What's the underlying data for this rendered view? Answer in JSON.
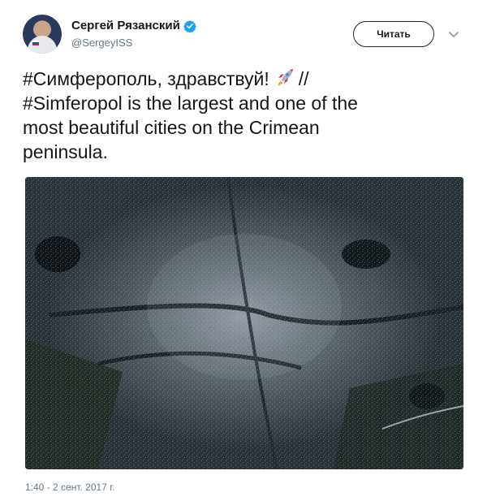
{
  "user": {
    "display_name": "Сергей Рязанский",
    "handle": "@SergeyISS",
    "verified": true
  },
  "actions": {
    "follow_label": "Читать"
  },
  "tweet": {
    "line1_before_icon": "#Симферополь, здравствуй!",
    "line1_after_icon": "//",
    "line2": "#Simferopol is the largest and one of the",
    "line3": "most beautiful cities on the Crimean",
    "line4": "peninsula.",
    "timestamp": "1:40 - 2 сент. 2017 г."
  },
  "icons": {
    "verified": "verified-badge-icon",
    "rocket": "rocket-emoji-icon",
    "menu": "chevron-down-icon"
  },
  "colors": {
    "text": "#14171a",
    "secondary": "#657786",
    "verified": "#1da1f2"
  }
}
